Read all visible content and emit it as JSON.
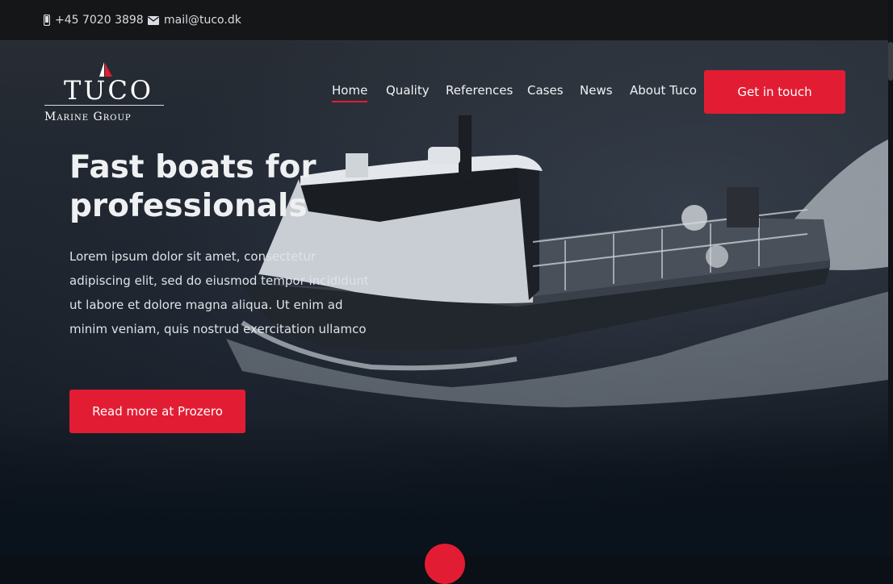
{
  "topbar": {
    "phone": "+45 7020 3898",
    "email": "mail@tuco.dk",
    "phone_icon": "phone-icon",
    "email_icon": "envelope-icon"
  },
  "logo": {
    "name": "Tuco",
    "subtitle": "Marine Group"
  },
  "nav": {
    "items": [
      {
        "label": "Home",
        "active": true
      },
      {
        "label": "Quality"
      },
      {
        "label": "References"
      },
      {
        "label": "Cases"
      },
      {
        "label": "News"
      },
      {
        "label": "About Tuco"
      }
    ],
    "cta_label": "Get in touch"
  },
  "hero": {
    "title": "Fast boats for professionals",
    "text": "Lorem ipsum dolor sit amet, consectetur adipiscing elit, sed do eiusmod tempor incididunt ut labore et dolore magna aliqua. Ut enim ad minim veniam, quis nostrud exercitation ullamco",
    "button_label": "Read more at Prozero"
  },
  "colors": {
    "accent": "#e21d33",
    "topbar": "#141618"
  }
}
